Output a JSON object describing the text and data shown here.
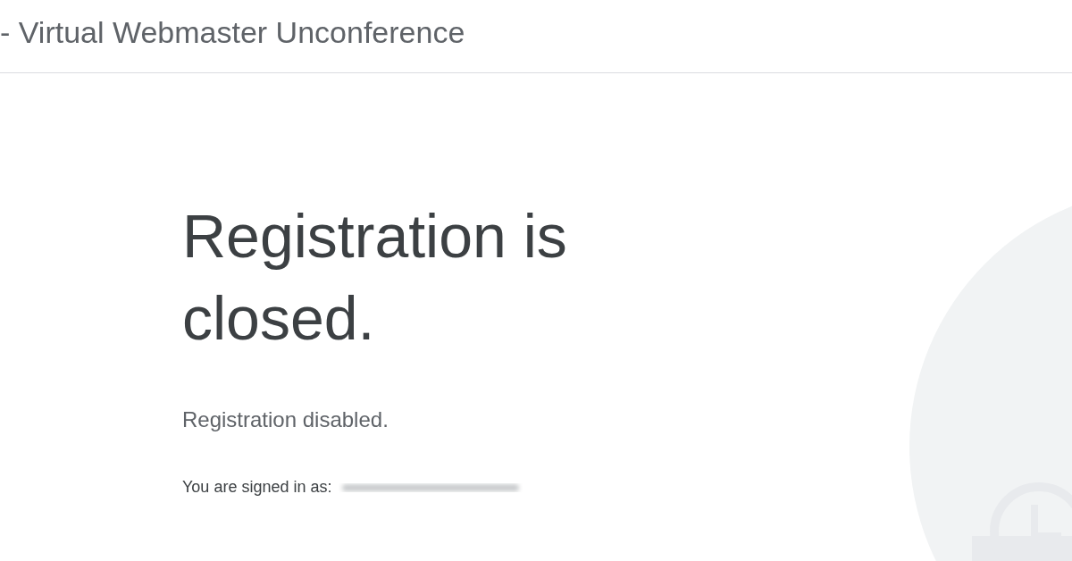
{
  "header": {
    "title": "- Virtual Webmaster Unconference"
  },
  "main": {
    "heading": "Registration is closed.",
    "message": "Registration disabled.",
    "signed_in_label": "You are signed in as:"
  }
}
